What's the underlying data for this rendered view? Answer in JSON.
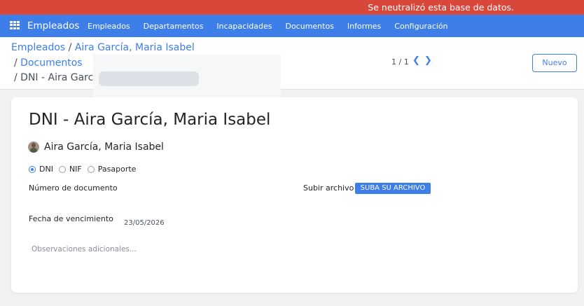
{
  "banner": {
    "text": "Se neutralizó esta base de datos."
  },
  "navbar": {
    "icon": "apps-grid-icon",
    "app_name": "Empleados",
    "menu": [
      "Empleados",
      "Departamentos",
      "Incapacidades",
      "Documentos",
      "Informes",
      "Configuración"
    ]
  },
  "breadcrumb": {
    "items": [
      "Empleados",
      "Aira García, Maria Isabel",
      "Documentos"
    ],
    "current": "DNI - Aira Garcí"
  },
  "pager": {
    "value": "1 / 1",
    "prev_icon": "chevron-left-icon",
    "next_icon": "chevron-right-icon"
  },
  "actions": {
    "new_label": "Nuevo"
  },
  "form": {
    "title": "DNI - Aira García, Maria Isabel",
    "employee": "Aira García, Maria Isabel",
    "doc_types": [
      {
        "label": "DNI",
        "selected": true
      },
      {
        "label": "NIF",
        "selected": false
      },
      {
        "label": "Pasaporte",
        "selected": false
      }
    ],
    "doc_number_label": "Número de documento",
    "upload_label": "Subir archivo",
    "upload_button": "SUBA SU ARCHIVO",
    "expiration_label": "Fecha de vencimiento",
    "expiration_value": "23/05/2026",
    "notes_placeholder": "Observaciones adicionales..."
  },
  "colors": {
    "banner": "#d9473a",
    "navbar": "#3d7ee9",
    "accent": "#3d7ee9"
  }
}
